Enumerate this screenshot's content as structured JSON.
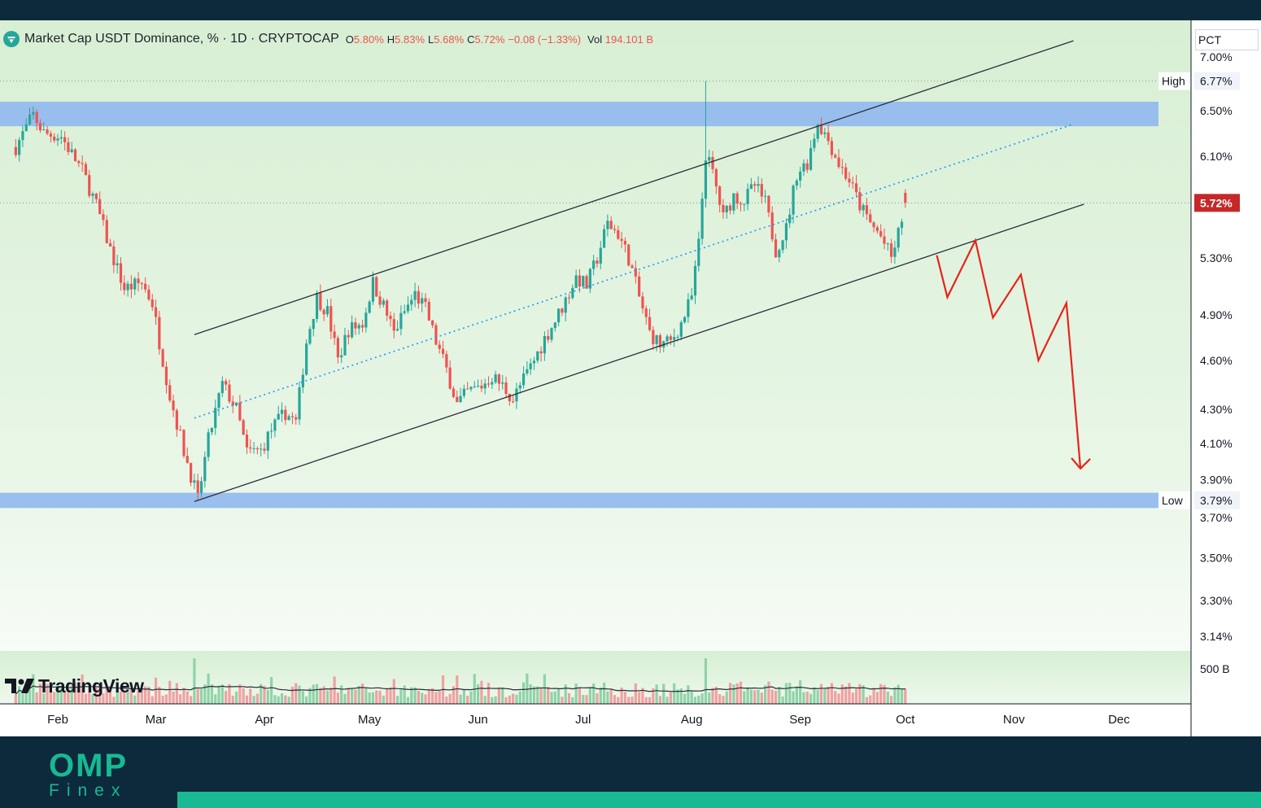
{
  "header": {
    "title": "Market Cap USDT Dominance, % · 1D · CRYPTOCAP",
    "ohlc": {
      "o_label": "O",
      "o": "5.80%",
      "h_label": "H",
      "h": "5.83%",
      "l_label": "L",
      "l": "5.68%",
      "c_label": "C",
      "c": "5.72%",
      "change": "−0.08 (−1.33%)"
    },
    "vol_label": "Vol",
    "vol": "194.101 B",
    "scale_mode": "PCT"
  },
  "chart_data": {
    "type": "candlestick",
    "title": "Market Cap USDT Dominance, % · 1D · CRYPTOCAP",
    "x_axis": {
      "ticks": [
        "Feb",
        "Mar",
        "Apr",
        "May",
        "Jun",
        "Jul",
        "Aug",
        "Sep",
        "Oct",
        "Nov",
        "Dec"
      ]
    },
    "y_axis": {
      "scale": "log",
      "ticks": [
        "7.00%",
        "6.50%",
        "6.10%",
        "5.30%",
        "4.90%",
        "4.60%",
        "4.30%",
        "4.10%",
        "3.90%",
        "3.70%",
        "3.50%",
        "3.30%",
        "3.14%"
      ],
      "ylim": [
        3.14,
        7.05
      ]
    },
    "markers": {
      "high": {
        "label": "High",
        "value": "6.77%"
      },
      "low": {
        "label": "Low",
        "value": "3.79%"
      },
      "last": {
        "value": "5.72%"
      }
    },
    "zones": [
      {
        "name": "resistance",
        "from": 6.36,
        "to": 6.58,
        "color": "#90b8f0"
      },
      {
        "name": "support",
        "from": 3.75,
        "to": 3.83,
        "color": "#90b8f0"
      }
    ],
    "price_path": [
      [
        "Jan 20",
        6.18
      ],
      [
        "Jan 25",
        6.46
      ],
      [
        "Jan 28",
        6.3
      ],
      [
        "Feb 2",
        6.27
      ],
      [
        "Feb 5",
        6.12
      ],
      [
        "Feb 8",
        5.98
      ],
      [
        "Feb 12",
        5.7
      ],
      [
        "Feb 16",
        5.36
      ],
      [
        "Feb 20",
        5.08
      ],
      [
        "Feb 25",
        5.12
      ],
      [
        "Feb 28",
        4.98
      ],
      [
        "Mar 2",
        4.72
      ],
      [
        "Mar 5",
        4.38
      ],
      [
        "Mar 9",
        4.06
      ],
      [
        "Mar 12",
        3.86
      ],
      [
        "Mar 13",
        3.79
      ],
      [
        "Mar 16",
        4.12
      ],
      [
        "Mar 20",
        4.45
      ],
      [
        "Mar 24",
        4.3
      ],
      [
        "Mar 27",
        4.05
      ],
      [
        "Mar 31",
        4.06
      ],
      [
        "Apr 3",
        4.18
      ],
      [
        "Apr 7",
        4.28
      ],
      [
        "Apr 10",
        4.22
      ],
      [
        "Apr 13",
        4.72
      ],
      [
        "Apr 16",
        5.02
      ],
      [
        "Apr 19",
        4.92
      ],
      [
        "Apr 22",
        4.6
      ],
      [
        "Apr 25",
        4.8
      ],
      [
        "Apr 29",
        4.84
      ],
      [
        "May 2",
        5.12
      ],
      [
        "May 5",
        4.96
      ],
      [
        "May 8",
        4.78
      ],
      [
        "May 11",
        4.92
      ],
      [
        "May 14",
        5.04
      ],
      [
        "May 17",
        4.94
      ],
      [
        "May 20",
        4.72
      ],
      [
        "May 23",
        4.54
      ],
      [
        "May 26",
        4.33
      ],
      [
        "May 29",
        4.4
      ],
      [
        "Jun 2",
        4.44
      ],
      [
        "Jun 5",
        4.5
      ],
      [
        "Jun 8",
        4.44
      ],
      [
        "Jun 11",
        4.36
      ],
      [
        "Jun 14",
        4.48
      ],
      [
        "Jun 17",
        4.6
      ],
      [
        "Jun 20",
        4.74
      ],
      [
        "Jun 23",
        4.86
      ],
      [
        "Jun 26",
        5.0
      ],
      [
        "Jun 29",
        5.16
      ],
      [
        "Jul 2",
        5.1
      ],
      [
        "Jul 5",
        5.3
      ],
      [
        "Jul 8",
        5.56
      ],
      [
        "Jul 11",
        5.48
      ],
      [
        "Jul 14",
        5.3
      ],
      [
        "Jul 17",
        5.02
      ],
      [
        "Jul 20",
        4.78
      ],
      [
        "Jul 23",
        4.7
      ],
      [
        "Jul 26",
        4.72
      ],
      [
        "Jul 29",
        4.84
      ],
      [
        "Aug 1",
        5.02
      ],
      [
        "Aug 3",
        5.4
      ],
      [
        "Aug 5",
        6.12
      ],
      [
        "Aug 7",
        5.96
      ],
      [
        "Aug 10",
        5.6
      ],
      [
        "Aug 13",
        5.78
      ],
      [
        "Aug 16",
        5.74
      ],
      [
        "Aug 19",
        5.86
      ],
      [
        "Aug 22",
        5.72
      ],
      [
        "Aug 25",
        5.36
      ],
      [
        "Aug 28",
        5.52
      ],
      [
        "Aug 31",
        5.96
      ],
      [
        "Sep 3",
        6.05
      ],
      [
        "Sep 6",
        6.4
      ],
      [
        "Sep 9",
        6.24
      ],
      [
        "Sep 12",
        6.04
      ],
      [
        "Sep 15",
        5.9
      ],
      [
        "Sep 18",
        5.7
      ],
      [
        "Sep 21",
        5.56
      ],
      [
        "Sep 24",
        5.46
      ],
      [
        "Sep 27",
        5.3
      ],
      [
        "Sep 29",
        5.48
      ],
      [
        "Oct 1",
        5.72
      ]
    ],
    "volume_axis": {
      "tick": "500 B"
    }
  },
  "watermark": {
    "brand": "TradingView"
  },
  "footer_logo": {
    "main": "OMP",
    "sub": "Finex"
  },
  "colors": {
    "bg_green_top": "#d8efd4",
    "bg_green_bottom": "#f2faf1",
    "candle_up": "#26a69a",
    "candle_down": "#ef5350",
    "channel_line": "#2a2e39",
    "midline": "#2196f3",
    "projection": "#e8231b",
    "footer_bg": "#0d2a3c",
    "footer_accent": "#18b993",
    "last_price_badge": "#c62828"
  }
}
